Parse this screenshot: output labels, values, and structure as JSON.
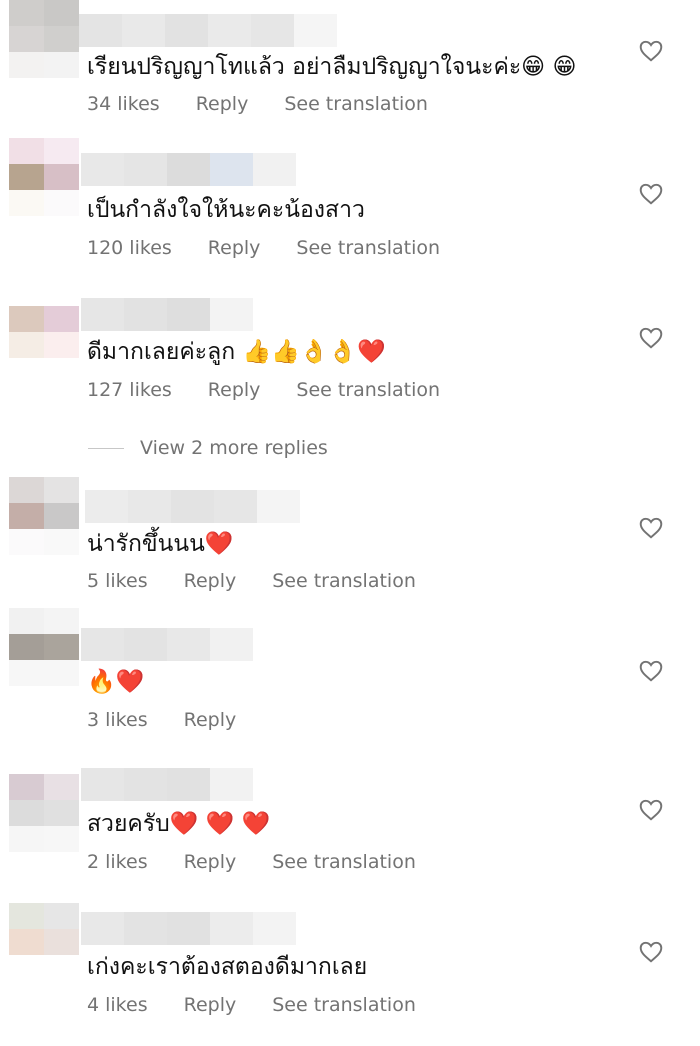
{
  "comments": [
    {
      "text": "เรียนปริญญาโทแล้ว อย่าลืมปริญญาใจนะค่ะ😁 😁",
      "likes": "34 likes",
      "reply": "Reply",
      "translate": "See translation",
      "avatar_colors": [
        "#cfcdcb",
        "#c9c8c6",
        "#d7d4d3",
        "#d0cfcd",
        "#f3f2f1",
        "#f3f3f3"
      ],
      "name_colors": [
        "#e4e4e4",
        "#e9e9e9",
        "#e2e2e2",
        "#eaeaea",
        "#e6e6e6",
        "#f5f5f5"
      ]
    },
    {
      "text": "เป็นกำลังใจให้นะคะน้องสาว",
      "likes": "120 likes",
      "reply": "Reply",
      "translate": "See translation",
      "avatar_colors": [
        "#f1dfe6",
        "#f6eaf1",
        "#b7a48f",
        "#d7bfc6",
        "#fbf9f4",
        "#fbfafb"
      ],
      "name_colors": [
        "#e8e8e8",
        "#e5e5e5",
        "#dcdcdc",
        "#dde4ee",
        "#f1f1f1"
      ]
    },
    {
      "text": "ดีมากเลยค่ะลูก 👍👍👌👌❤️",
      "likes": "127 likes",
      "reply": "Reply",
      "translate": "See translation",
      "avatar_colors": [
        "#dcc9bd",
        "#e4ccd8",
        "#f5ede5",
        "#fbeeee",
        "#ffffff",
        "#ffffff"
      ],
      "name_colors": [
        "#e6e6e6",
        "#e2e2e2",
        "#dedede",
        "#f3f3f3"
      ]
    },
    {
      "text": "น่ารักขึ้นนน❤️",
      "likes": "5 likes",
      "reply": "Reply",
      "translate": "See translation",
      "avatar_colors": [
        "#dcd7d6",
        "#e4e3e3",
        "#c4aea8",
        "#c9c8c8",
        "#fbfafb",
        "#f9f9f9"
      ],
      "name_colors": [
        "#ececec",
        "#e8e8e8",
        "#e3e3e3",
        "#e6e6e6",
        "#f4f4f4"
      ]
    },
    {
      "text": "🔥❤️",
      "likes": "3 likes",
      "reply": "Reply",
      "translate": "",
      "avatar_colors": [
        "#f1f1f1",
        "#f4f4f4",
        "#a49e97",
        "#aaa49c",
        "#f7f7f7",
        "#f7f7f7"
      ],
      "name_colors": [
        "#e6e6e6",
        "#e3e3e3",
        "#e8e8e8",
        "#f1f1f1"
      ]
    },
    {
      "text": "สวยครับ❤️ ❤️ ❤️",
      "likes": "2 likes",
      "reply": "Reply",
      "translate": "See translation",
      "avatar_colors": [
        "#d8cbd2",
        "#e8e0e4",
        "#dcdcdc",
        "#e0e0e0",
        "#f6f6f6",
        "#f7f7f7"
      ],
      "name_colors": [
        "#e6e6e6",
        "#e3e3e3",
        "#e1e1e1",
        "#f2f2f2"
      ]
    },
    {
      "text": "เก่งคะเราต้องสตองดีมากเลย",
      "likes": "4 likes",
      "reply": "Reply",
      "translate": "See translation",
      "avatar_colors": [
        "#e4e6de",
        "#e6e6e6",
        "#efdcd0",
        "#eae0dc",
        "#ffffff",
        "#ffffff"
      ],
      "name_colors": [
        "#e8e8e8",
        "#e3e3e3",
        "#e1e1e1",
        "#ececec",
        "#f3f3f3"
      ]
    }
  ],
  "view_more_replies": "View 2 more replies",
  "colors": {
    "meta": "#737373",
    "heart_stroke": "#737373"
  },
  "icons": {
    "like": "heart-outline-icon"
  }
}
